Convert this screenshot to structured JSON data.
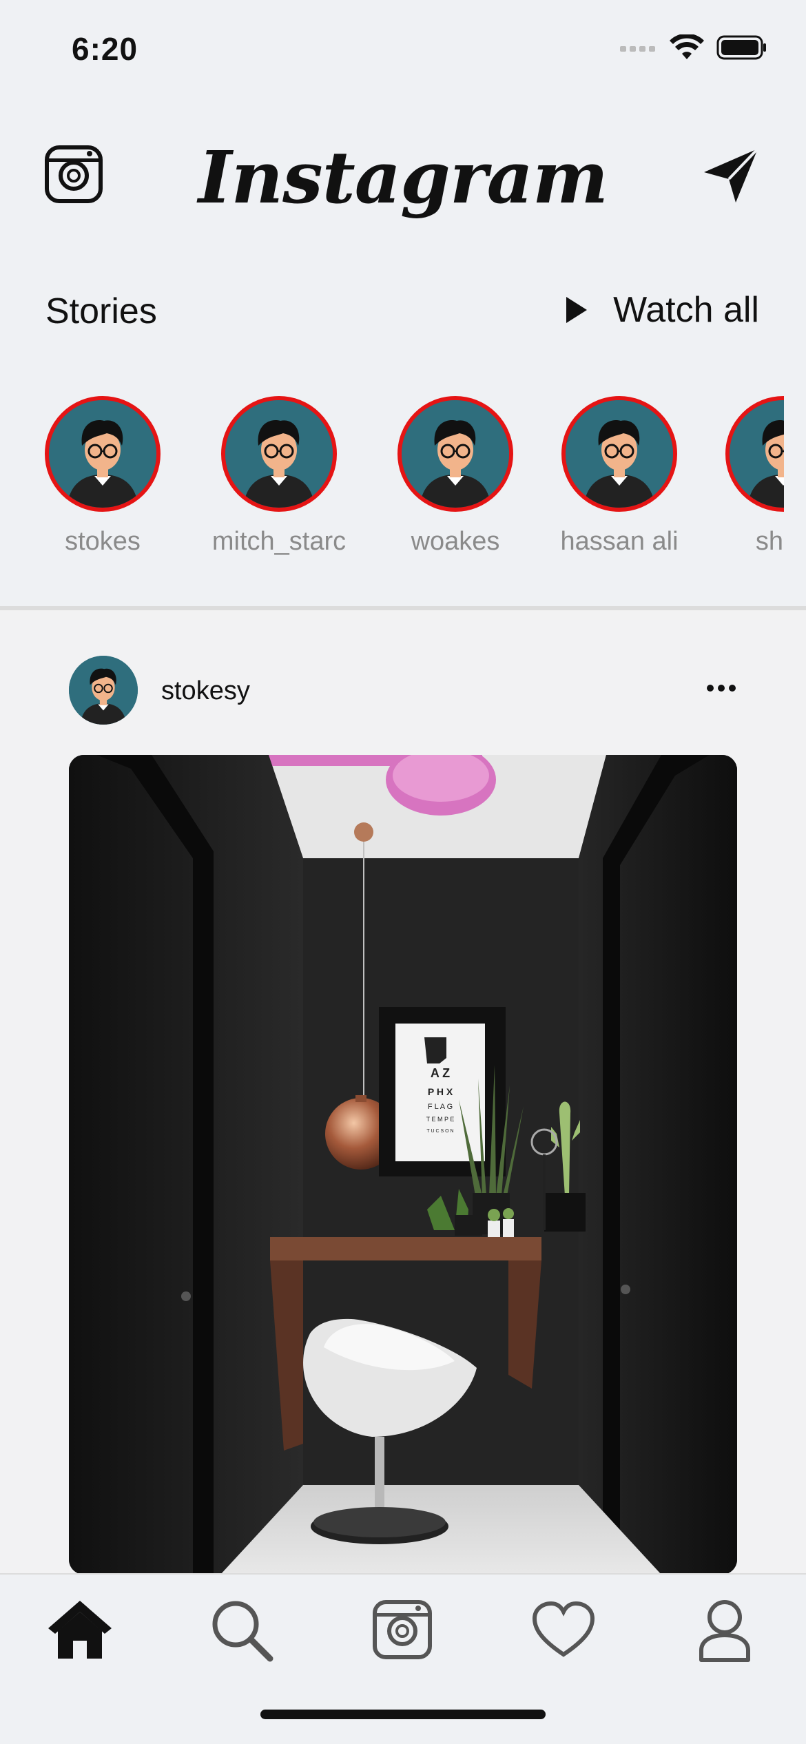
{
  "status_bar": {
    "time": "6:20"
  },
  "header": {
    "logo_text": "Instagram"
  },
  "stories": {
    "title": "Stories",
    "watch_all_label": "Watch all",
    "items": [
      {
        "name": "stokes"
      },
      {
        "name": "mitch_starc"
      },
      {
        "name": "woakes"
      },
      {
        "name": "hassan ali"
      },
      {
        "name": "shak"
      }
    ]
  },
  "post": {
    "username": "stokesy",
    "chart_text": [
      "A Z",
      "P H X",
      "F L A G",
      "T E M P E",
      "T U C S O N"
    ]
  },
  "tab_bar": {
    "items": [
      "home-icon",
      "search-icon",
      "camera-icon",
      "heart-icon",
      "profile-icon"
    ]
  },
  "colors": {
    "story_ring": "#e51414",
    "avatar_bg": "#2f6e7d",
    "accent_pink": "#d774c0"
  }
}
